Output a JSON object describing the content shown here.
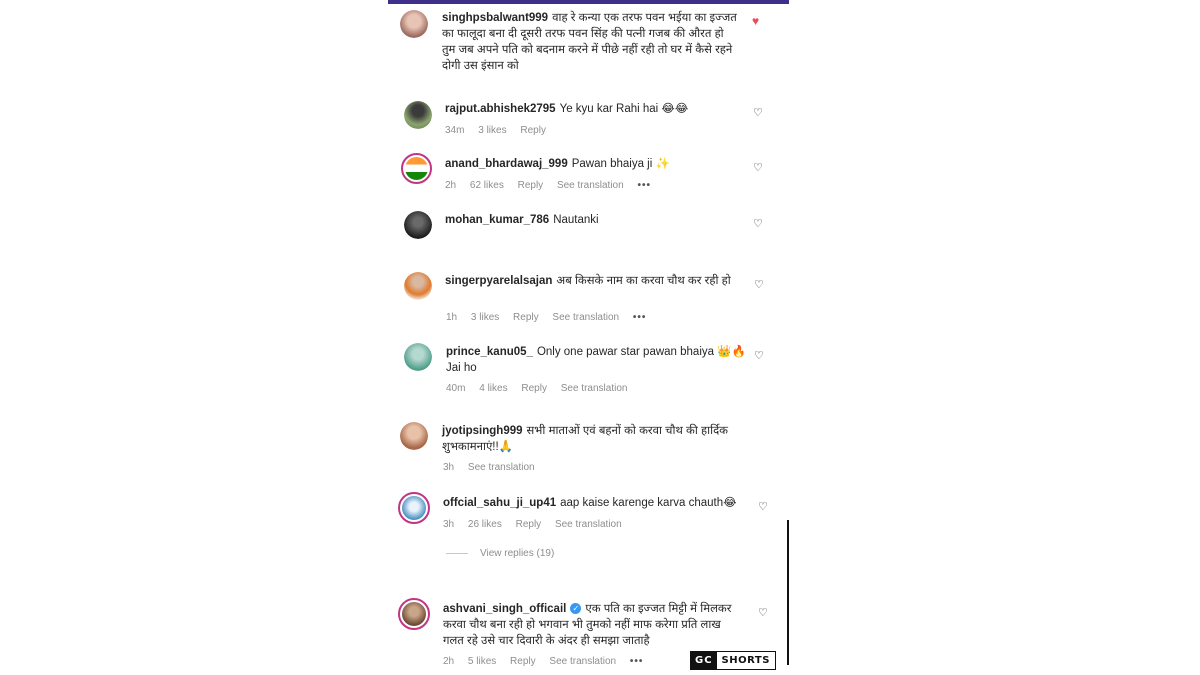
{
  "comments": [
    {
      "username": "singhpsbalwant999",
      "text": "वाह रे कन्या एक तरफ पवन भईया का इज्जत का फालूदा बना दी दूसरी तरफ पवन सिंह की पत्नी गजब की औरत हो तुम जब अपने पति को बदनाम करने में पीछे नहीं रही तो घर में कैसे रहने दोगी उस इंसान को",
      "time": "",
      "likes": "",
      "reply": "",
      "translation": "",
      "liked": true
    },
    {
      "username": "rajput.abhishek2795",
      "text": "Ye kyu kar Rahi hai 😂😂",
      "time": "34m",
      "likes": "3 likes",
      "reply": "Reply",
      "translation": ""
    },
    {
      "username": "anand_bhardawaj_999",
      "text": "Pawan bhaiya ji ✨",
      "time": "2h",
      "likes": "62 likes",
      "reply": "Reply",
      "translation": "See translation"
    },
    {
      "username": "mohan_kumar_786",
      "text": "Nautanki",
      "time": "",
      "likes": "",
      "reply": "",
      "translation": ""
    },
    {
      "username": "singerpyarelalsajan",
      "text": "अब किसके नाम का करवा चौथ कर रही हो",
      "time": "1h",
      "likes": "3 likes",
      "reply": "Reply",
      "translation": "See translation"
    },
    {
      "username": "prince_kanu05_",
      "text": "Only one pawar star pawan bhaiya 👑🔥 Jai ho",
      "time": "40m",
      "likes": "4 likes",
      "reply": "Reply",
      "translation": "See translation"
    },
    {
      "username": "jyotipsingh999",
      "text": "सभी माताओं एवं बहनों को करवा चौथ की हार्दिक शुभकामनाएं!!🙏",
      "time": "3h",
      "likes": "",
      "reply": "",
      "translation": "See translation"
    },
    {
      "username": "offcial_sahu_ji_up41",
      "text": "aap kaise karenge karva chauth😂",
      "time": "3h",
      "likes": "26 likes",
      "reply": "Reply",
      "translation": "See translation"
    },
    {
      "username": "ashvani_singh_officail",
      "text": "एक पति का इज्जत मिट्टी में मिलकर करवा चौथ बना रही हो भगवान भी तुमको नहीं माफ करेगा प्रति लाख गलत रहे उसे चार दिवारी के अंदर ही समझा जाताहै",
      "time": "2h",
      "likes": "5 likes",
      "reply": "Reply",
      "translation": "See translation",
      "verified": true
    }
  ],
  "view_replies": "View replies (19)",
  "watermark": {
    "gc": "GC",
    "shorts": "SHORTS"
  },
  "icons": {
    "like": "heart-outline-icon",
    "liked": "heart-filled-icon",
    "more": "more-dots-icon",
    "verified": "verified-badge-icon"
  },
  "colors": {
    "liked": "#ed4956",
    "meta": "#8e8e8e",
    "verified": "#3897f0",
    "topbar": "#3d2f8a"
  }
}
